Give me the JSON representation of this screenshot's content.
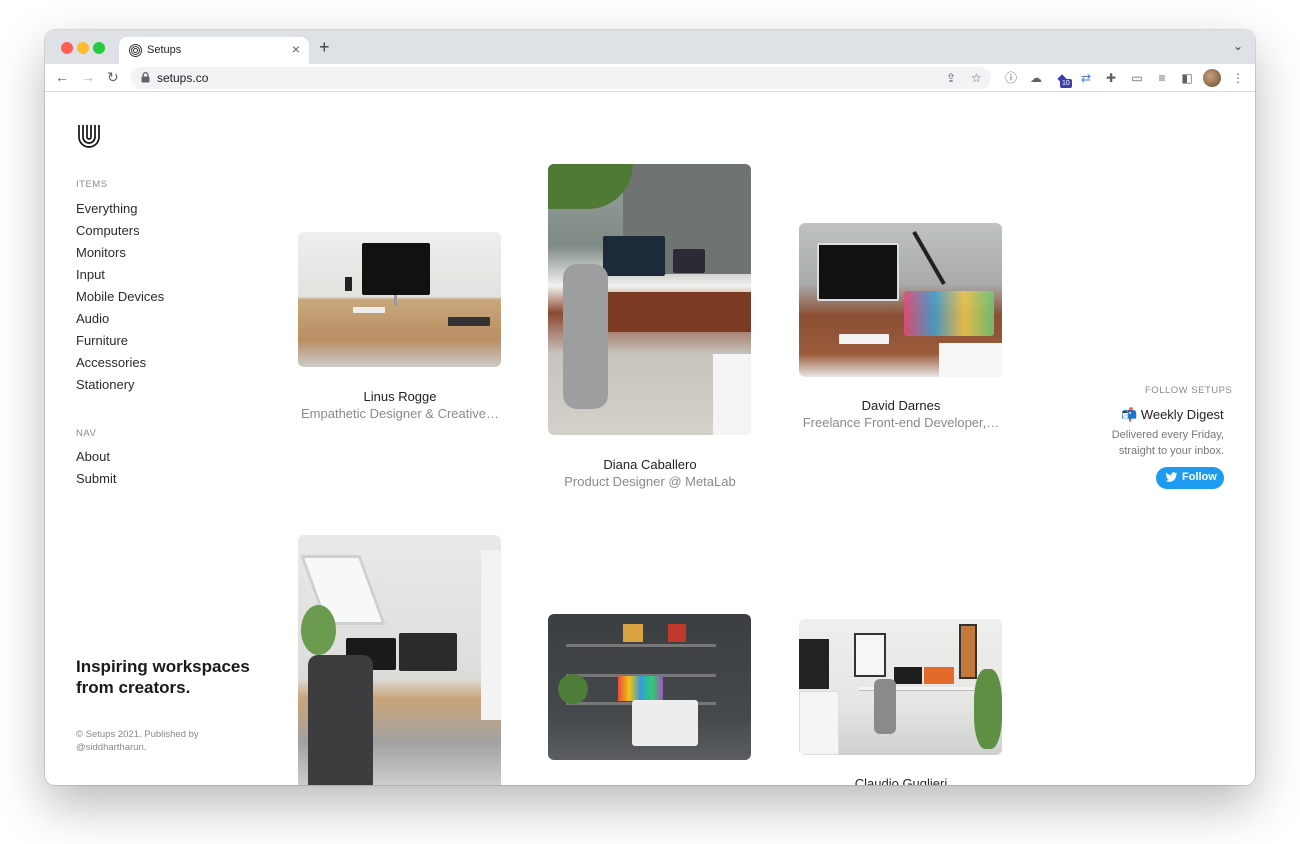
{
  "browser": {
    "tab_title": "Setups",
    "url": "setups.co",
    "extension_badge": "10"
  },
  "sidebar": {
    "items_label": "ITEMS",
    "items": [
      "Everything",
      "Computers",
      "Monitors",
      "Input",
      "Mobile Devices",
      "Audio",
      "Furniture",
      "Accessories",
      "Stationery"
    ],
    "nav_label": "NAV",
    "nav": [
      "About",
      "Submit"
    ],
    "tagline": "Inspiring workspaces from creators.",
    "copyright": "© Setups 2021. Published by @siddhartharun."
  },
  "cards": [
    {
      "name": "Linus Rogge",
      "role": "Empathetic Designer & Creative…"
    },
    {
      "name": "Diana Caballero",
      "role": "Product Designer @ MetaLab"
    },
    {
      "name": "David Darnes",
      "role": "Freelance Front-end Developer,…"
    },
    {
      "name": "",
      "role": ""
    },
    {
      "name": "",
      "role": ""
    },
    {
      "name": "Claudio Guglieri",
      "role": ""
    }
  ],
  "follow": {
    "label": "FOLLOW SETUPS",
    "digest_emoji": "📬",
    "digest_title": "Weekly Digest",
    "digest_desc": "Delivered every Friday, straight to your inbox.",
    "button": "Follow"
  },
  "icons": {
    "back": "arrow-left-icon",
    "forward": "arrow-right-icon",
    "reload": "reload-icon",
    "lock": "lock-icon",
    "share": "share-icon",
    "star": "star-icon",
    "extensions": "puzzle-icon",
    "twitter": "twitter-bird-icon"
  },
  "colors": {
    "accent": "#1d9bf0",
    "text_primary": "#222222",
    "text_muted": "#8a8a8a"
  }
}
